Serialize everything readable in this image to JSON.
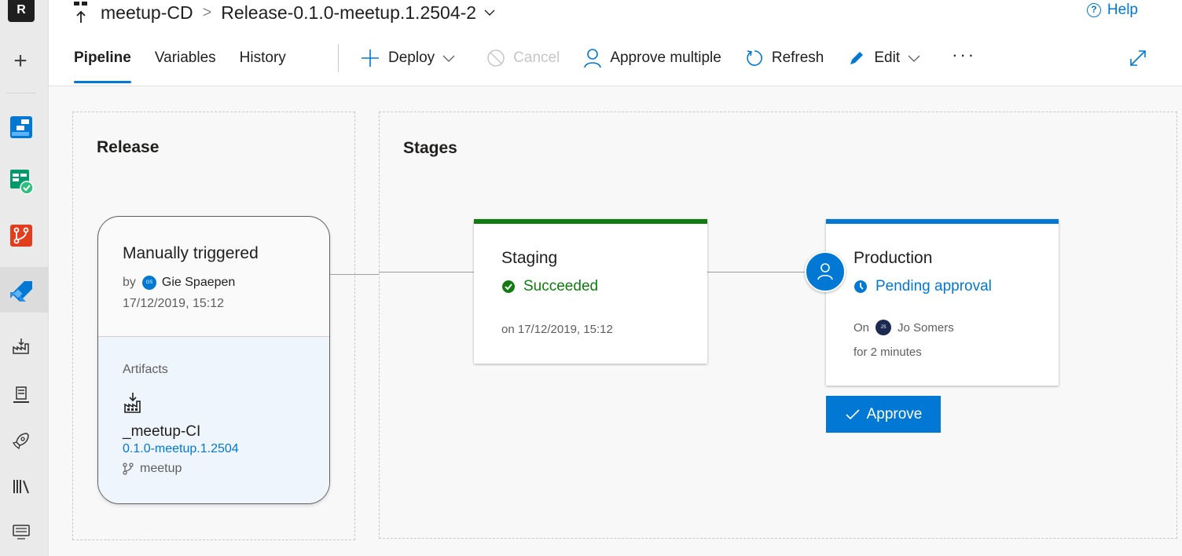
{
  "rail": {
    "org_letter": "R",
    "items": [
      "new-icon",
      "boards-icon",
      "test-plans-icon",
      "repos-icon",
      "pipelines-icon",
      "artifacts-icon",
      "builds-icon",
      "releases-icon",
      "library-icon",
      "deployment-groups-icon"
    ]
  },
  "header": {
    "pipeline_name": "meetup-CD",
    "breadcrumb_separator": ">",
    "release_name": "Release-0.1.0-meetup.1.2504-2",
    "help_label": "Help"
  },
  "tabs": [
    {
      "label": "Pipeline",
      "active": true
    },
    {
      "label": "Variables",
      "active": false
    },
    {
      "label": "History",
      "active": false
    }
  ],
  "toolbar": {
    "deploy_label": "Deploy",
    "cancel_label": "Cancel",
    "approve_multiple_label": "Approve multiple",
    "refresh_label": "Refresh",
    "edit_label": "Edit",
    "more_label": "···"
  },
  "release_panel": {
    "title": "Release",
    "trigger": "Manually triggered",
    "by_prefix": "by",
    "user_initials": "GS",
    "user_name": "Gie Spaepen",
    "date": "17/12/2019, 15:12",
    "artifacts_label": "Artifacts",
    "artifact_name": "_meetup-CI",
    "artifact_version": "0.1.0-meetup.1.2504",
    "artifact_branch": "meetup"
  },
  "stages_panel": {
    "title": "Stages",
    "stages": [
      {
        "name": "Staging",
        "status": "Succeeded",
        "status_color": "#107c10",
        "date": "on 17/12/2019, 15:12"
      },
      {
        "name": "Production",
        "status": "Pending approval",
        "status_color": "#0078d4",
        "on_prefix": "On",
        "approver_initials": "JS",
        "approver_name": "Jo Somers",
        "duration": "for 2 minutes",
        "approve_label": "Approve"
      }
    ]
  },
  "colors": {
    "accent": "#0078d4",
    "success": "#107c10"
  }
}
